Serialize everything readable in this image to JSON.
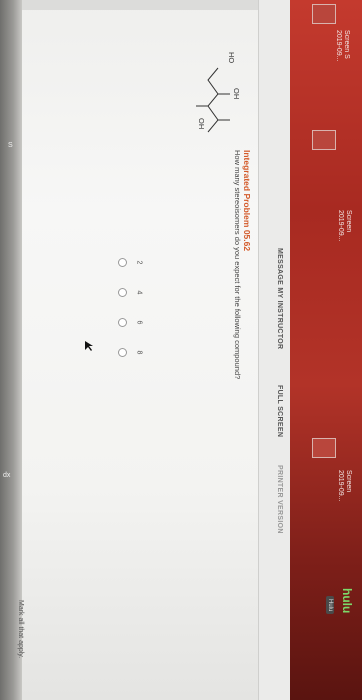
{
  "left_strip": {
    "marks": [
      "S",
      "dx"
    ]
  },
  "toolbar": {
    "message_instructor": "MESSAGE MY INSTRUCTOR",
    "full_screen": "FULL SCREEN",
    "print_label": "PRINTER VERSION"
  },
  "question": {
    "title": "Integrated Problem 05.62",
    "prompt": "How many stereoisomers do you expect for the following compound?",
    "molecule_labels": {
      "ho": "HO",
      "oh_top": "OH",
      "oh_right": "OH"
    },
    "options": [
      "2",
      "4",
      "6",
      "8"
    ],
    "footer_hint": "Mark all that apply."
  },
  "desktop": {
    "items": [
      {
        "label": "Screen S",
        "sub": "2019-09..."
      },
      {
        "label": "Screen",
        "sub": "2019-09..."
      },
      {
        "label": "Screen",
        "sub": "2019-09..."
      }
    ],
    "hulu": "hulu",
    "hulu_small": "Hulu"
  },
  "colors": {
    "accent_title": "#d35a2a",
    "desktop_red": "#b23328",
    "hulu_green": "#7cd96a"
  }
}
